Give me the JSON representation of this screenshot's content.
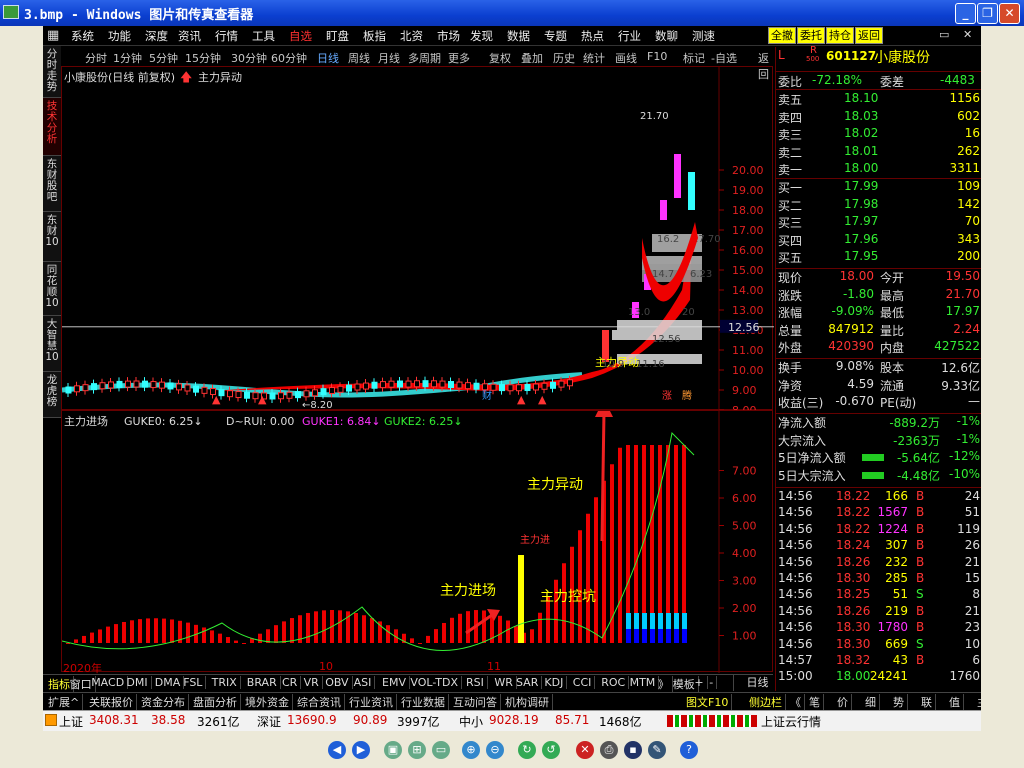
{
  "window": {
    "title": "3.bmp - Windows 图片和传真查看器",
    "min": "_",
    "max": "❐",
    "close": "✕"
  },
  "menu": [
    "系统",
    "功能",
    "深度",
    "资讯",
    "行情",
    "工具",
    "自选",
    "盯盘",
    "板指",
    "北资",
    "市场",
    "发现",
    "数据",
    "专题",
    "热点",
    "行业",
    "数聊",
    "测速"
  ],
  "menu_selected": "自选",
  "menu_buttons": [
    "全撤",
    "委托",
    "持仓",
    "返回"
  ],
  "periods": [
    "分时",
    "1分钟",
    "5分钟",
    "15分钟",
    "30分钟",
    "60分钟",
    "日线",
    "周线",
    "月线",
    "多周期",
    "更多"
  ],
  "period_selected": "日线",
  "tools": [
    "复权",
    "叠加",
    "历史",
    "统计",
    "画线",
    "F10",
    "标记",
    "-自选",
    "返回"
  ],
  "left_tabs": [
    "分时走势",
    "技术分析",
    "东财股吧",
    "东财10",
    "同花顺10",
    "大智慧10",
    "龙虎榜"
  ],
  "left_tab_selected": "技术分析",
  "kchart": {
    "title": "小康股份(日线 前复权)",
    "indicator": "主力异动",
    "yticks": [
      "20.00",
      "19.00",
      "18.00",
      "17.00",
      "16.00",
      "15.00",
      "14.00",
      "13.00",
      "12.00",
      "11.00",
      "10.00",
      "9.00",
      "8.00"
    ],
    "price_marker": "12.56",
    "ann_high": "21.70",
    "ann_low": "8.20",
    "box_labels": [
      "16.2",
      "17.70",
      "14.7",
      "6.23",
      "13.0",
      "20",
      "12.56",
      "10.9",
      "11.16"
    ],
    "signal": "主力异动",
    "tags": [
      "财",
      "涨",
      "腾"
    ]
  },
  "ichart": {
    "title": "主力进场",
    "guke0": "GUKE0: 6.25↓",
    "drui": "D~RUI: 0.00",
    "guke1": "GUKE1: 6.84↓",
    "guke2": "GUKE2: 6.25↓",
    "yticks": [
      "7.00",
      "6.00",
      "5.00",
      "4.00",
      "3.00",
      "2.00",
      "1.00"
    ],
    "label_red": "主力进",
    "ann1": "主力异动",
    "ann2": "主力进场",
    "ann3": "主力控坑"
  },
  "timeaxis": [
    "2020年",
    "10",
    "11"
  ],
  "indicators": [
    "指标",
    "窗口",
    "MACD",
    "DMI",
    "DMA",
    "FSL",
    "TRIX",
    "BRAR",
    "CR",
    "VR",
    "OBV",
    "ASI",
    "EMV",
    "VOL-TDX",
    "RSI",
    "WR",
    "SAR",
    "KDJ",
    "CCI",
    "ROC",
    "MTM",
    "》",
    "模板",
    "+",
    "-"
  ],
  "dayline": "日线",
  "features": [
    "扩展^",
    "关联报价",
    "资金分布",
    "盘面分析",
    "境外资金",
    "综合资讯",
    "行业资讯",
    "行业数据",
    "互动问答",
    "机构调研",
    "图文F10",
    "侧边栏",
    "《",
    "笔",
    "价",
    "细",
    "势",
    "联",
    "值",
    "主",
    "筹"
  ],
  "status": {
    "sh_name": "上证",
    "sh_val": "3408.31",
    "sh_chg": "38.58",
    "sh_amt": "3261亿",
    "sz_name": "深证",
    "sz_val": "13690.9",
    "sz_chg": "90.89",
    "sz_amt": "3997亿",
    "zx_name": "中小",
    "zx_val": "9028.19",
    "zx_chg": "85.71",
    "zx_amt": "1468亿",
    "right": "上证云行情"
  },
  "stock": {
    "code": "601127",
    "name": "小康股份",
    "tag": "L",
    "r": "R",
    "r_sub": "500"
  },
  "weibi": {
    "l1": "委比",
    "v1": "-72.18%",
    "l2": "委差",
    "v2": "-4483"
  },
  "asks": [
    [
      "卖五",
      "18.10",
      "1156"
    ],
    [
      "卖四",
      "18.03",
      "602"
    ],
    [
      "卖三",
      "18.02",
      "16"
    ],
    [
      "卖二",
      "18.01",
      "262"
    ],
    [
      "卖一",
      "18.00",
      "3311"
    ]
  ],
  "bids": [
    [
      "买一",
      "17.99",
      "109"
    ],
    [
      "买二",
      "17.98",
      "142"
    ],
    [
      "买三",
      "17.97",
      "70"
    ],
    [
      "买四",
      "17.96",
      "343"
    ],
    [
      "买五",
      "17.95",
      "200"
    ]
  ],
  "quote": [
    [
      "现价",
      "18.00",
      "今开",
      "19.50"
    ],
    [
      "涨跌",
      "-1.80",
      "最高",
      "21.70"
    ],
    [
      "涨幅",
      "-9.09%",
      "最低",
      "17.97"
    ],
    [
      "总量",
      "847912",
      "量比",
      "2.24"
    ],
    [
      "外盘",
      "420390",
      "内盘",
      "427522"
    ]
  ],
  "fund": [
    [
      "换手",
      "9.08%",
      "股本",
      "12.6亿"
    ],
    [
      "净资",
      "4.59",
      "流通",
      "9.33亿"
    ],
    [
      "收益(三)",
      "-0.670",
      "PE(动)",
      "—"
    ]
  ],
  "flows": [
    [
      "净流入额",
      "-889.2万",
      "-1%"
    ],
    [
      "大宗流入",
      "-2363万",
      "-1%"
    ],
    [
      "5日净流入额",
      "-5.64亿",
      "-12%"
    ],
    [
      "5日大宗流入",
      "-4.48亿",
      "-10%"
    ]
  ],
  "ticks": [
    [
      "14:56",
      "18.22",
      "166",
      "B",
      "24"
    ],
    [
      "14:56",
      "18.22",
      "1567",
      "B",
      "51"
    ],
    [
      "14:56",
      "18.22",
      "1224",
      "B",
      "119"
    ],
    [
      "14:56",
      "18.24",
      "307",
      "B",
      "26"
    ],
    [
      "14:56",
      "18.26",
      "232",
      "B",
      "21"
    ],
    [
      "14:56",
      "18.30",
      "285",
      "B",
      "15"
    ],
    [
      "14:56",
      "18.25",
      "51",
      "S",
      "8"
    ],
    [
      "14:56",
      "18.26",
      "219",
      "B",
      "21"
    ],
    [
      "14:56",
      "18.30",
      "1780",
      "B",
      "23"
    ],
    [
      "14:56",
      "18.30",
      "669",
      "S",
      "10"
    ],
    [
      "14:57",
      "18.32",
      "43",
      "B",
      "6"
    ],
    [
      "15:00",
      "18.00",
      "24241",
      "",
      "1760"
    ]
  ]
}
